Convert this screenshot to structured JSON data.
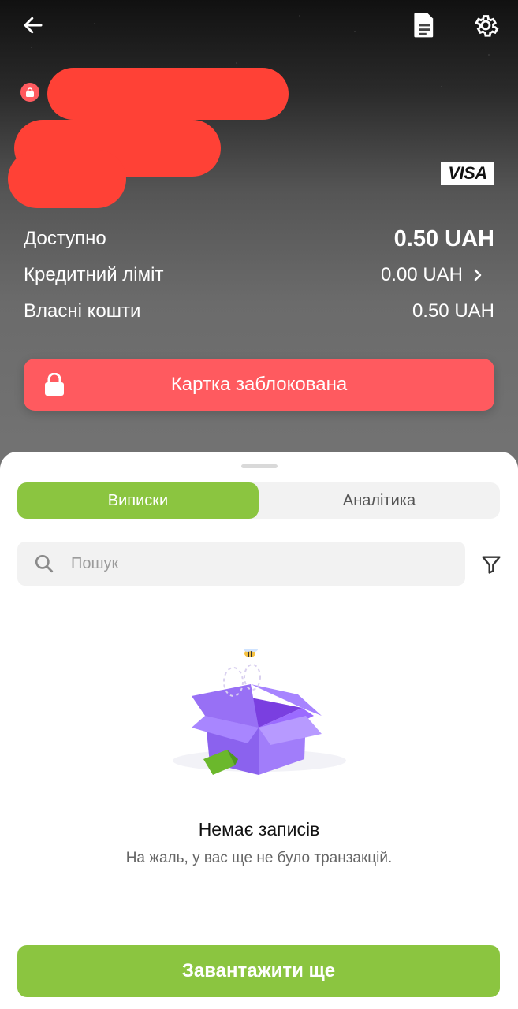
{
  "header": {
    "card_brand": "VISA",
    "balances": [
      {
        "label": "Доступно",
        "value": "0.50 UAH"
      },
      {
        "label": "Кредитний ліміт",
        "value": "0.00 UAH"
      },
      {
        "label": "Власні кошти",
        "value": "0.50 UAH"
      }
    ],
    "blocked_label": "Картка заблокована",
    "accent_color": "#ff5a5f"
  },
  "tabs": [
    {
      "label": "Виписки",
      "active": true
    },
    {
      "label": "Аналітика",
      "active": false
    }
  ],
  "search": {
    "placeholder": "Пошук"
  },
  "empty_state": {
    "title": "Немає записів",
    "subtitle": "На жаль, у вас ще не було транзакцій."
  },
  "load_more_label": "Завантажити ще",
  "brand_green": "#8bc540",
  "icons": [
    "back-arrow-icon",
    "document-icon",
    "gear-icon",
    "lock-icon",
    "chevron-right-icon",
    "search-icon",
    "filter-icon"
  ]
}
